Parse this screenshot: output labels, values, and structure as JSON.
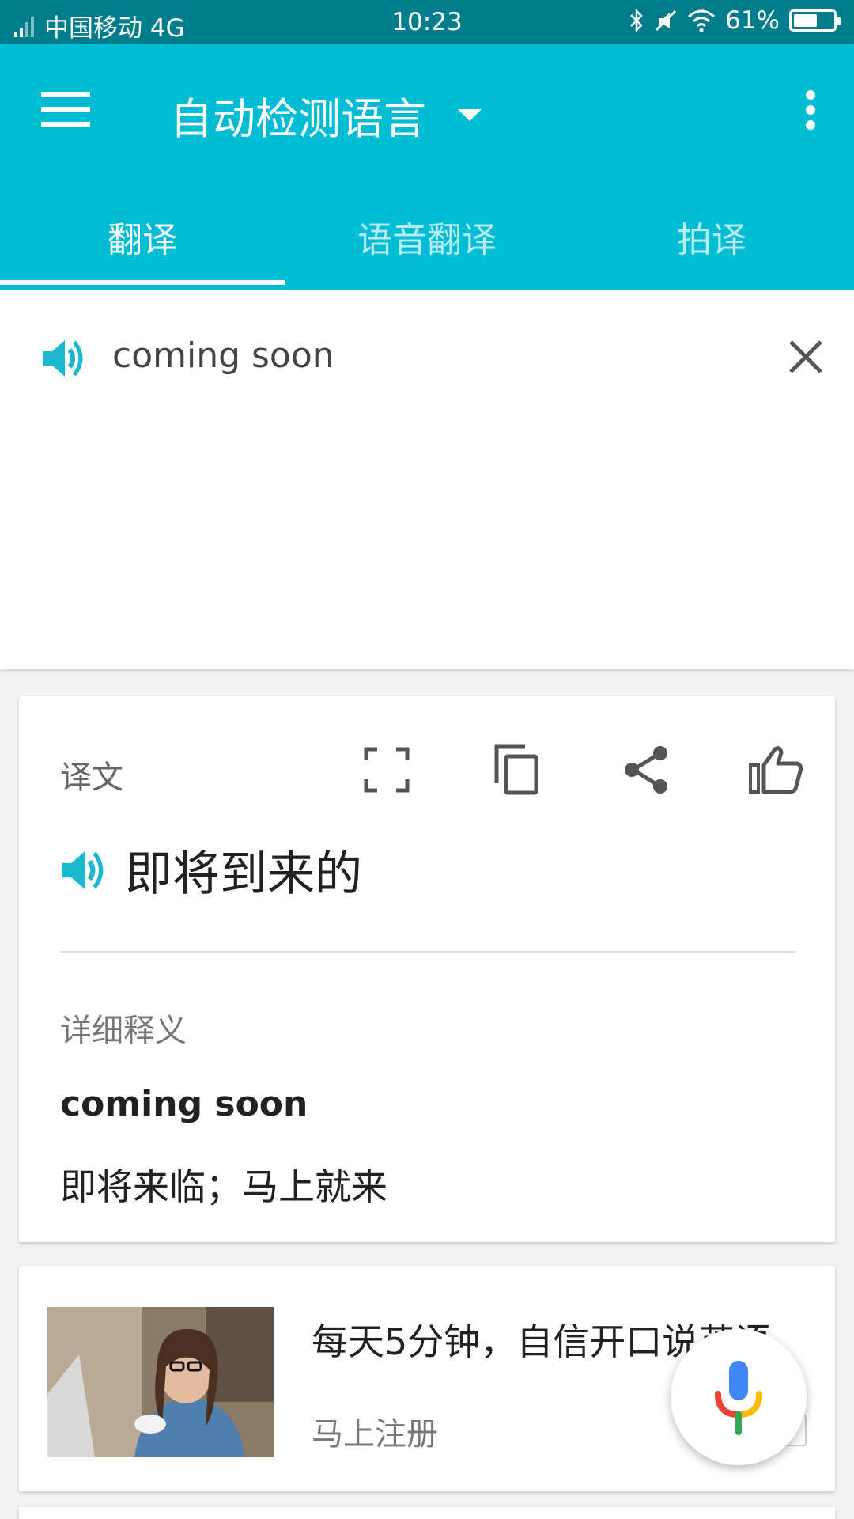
{
  "status_bar": {
    "carrier": "中国移动 4G",
    "time": "10:23",
    "battery": "61%",
    "battery_level": 0.61
  },
  "app_bar": {
    "language_selector": "自动检测语言",
    "tabs": [
      {
        "label": "翻译",
        "active": true
      },
      {
        "label": "语音翻译",
        "active": false
      },
      {
        "label": "拍译",
        "active": false
      }
    ]
  },
  "input": {
    "text": "coming soon"
  },
  "result": {
    "label": "译文",
    "translation": "即将到来的",
    "detail_title": "详细释义",
    "detail_term": "coming soon",
    "detail_meaning": "即将来临；马上就来"
  },
  "ad": {
    "title": "每天5分钟，自信开口说英语",
    "subtitle": "马上注册"
  },
  "colors": {
    "primary": "#00bcd4",
    "status_bar": "#007d8c",
    "accent_speaker": "#1cb8cf",
    "mic_blue": "#4285f4",
    "mic_red": "#ea4335",
    "mic_yellow": "#fbbc05",
    "mic_green": "#34a853"
  },
  "icons": {
    "menu": "menu-icon",
    "more": "more-vert-icon",
    "speaker": "speaker-icon",
    "clear": "close-icon",
    "fullscreen": "fullscreen-icon",
    "copy": "copy-icon",
    "share": "share-icon",
    "like": "thumbs-up-icon",
    "mic": "mic-icon"
  }
}
